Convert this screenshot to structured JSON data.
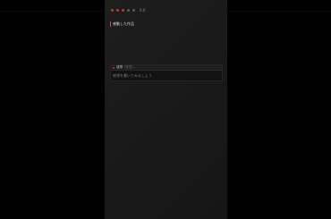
{
  "background": {
    "top_text": "・・・ ・・・・・・ ・・・・",
    "right_text": "・・・"
  },
  "rating": {
    "filled_stars": 3,
    "total_stars": 5,
    "value_text": "0.0"
  },
  "section": {
    "label": "感動した作品"
  },
  "input": {
    "header_label": "感想",
    "header_hint": "(任意)…",
    "placeholder": "感想を書いてみましょう"
  },
  "colors": {
    "accent": "#c0392b",
    "panel": "#1a1a1a",
    "page": "#000000"
  }
}
